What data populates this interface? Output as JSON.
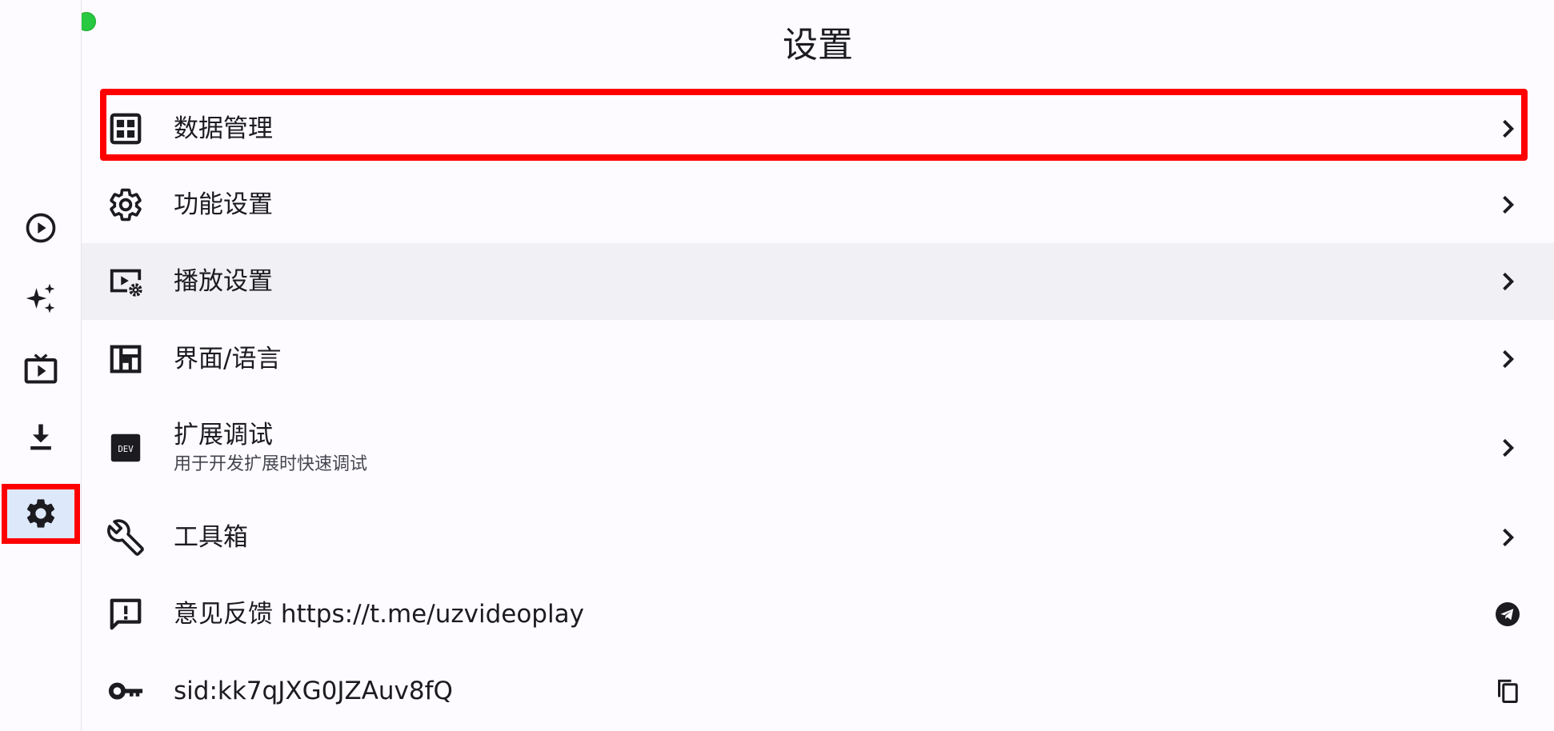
{
  "page": {
    "title": "设置"
  },
  "window_controls": {
    "close": "close",
    "minimize": "minimize",
    "maximize": "maximize"
  },
  "rail": {
    "items": [
      {
        "name": "play-circle-icon",
        "active": false
      },
      {
        "name": "sparkles-icon",
        "active": false
      },
      {
        "name": "tv-play-icon",
        "active": false
      },
      {
        "name": "download-icon",
        "active": false
      },
      {
        "name": "gear-icon",
        "active": true
      }
    ]
  },
  "settings": {
    "data_management": {
      "label": "数据管理",
      "icon": "grid-icon",
      "trailing_icon": "chevron-right-icon"
    },
    "feature_settings": {
      "label": "功能设置",
      "icon": "gear-icon",
      "trailing_icon": "chevron-right-icon"
    },
    "playback_settings": {
      "label": "播放设置",
      "icon": "video-settings-icon",
      "trailing_icon": "chevron-right-icon"
    },
    "ui_language": {
      "label": "界面/语言",
      "icon": "dashboard-icon",
      "trailing_icon": "chevron-right-icon"
    },
    "extension_debug": {
      "label": "扩展调试",
      "sublabel": "用于开发扩展时快速调试",
      "icon": "dev-icon",
      "icon_text": "DEV",
      "trailing_icon": "chevron-right-icon"
    },
    "toolbox": {
      "label": "工具箱",
      "icon": "wrench-icon",
      "trailing_icon": "chevron-right-icon"
    },
    "feedback": {
      "label": "意见反馈 https://t.me/uzvideoplay",
      "icon": "feedback-icon",
      "trailing_icon": "telegram-icon"
    },
    "sid": {
      "label": "sid:kk7qJXG0JZAuv8fQ",
      "icon": "key-icon",
      "trailing_icon": "copy-icon"
    }
  },
  "colors": {
    "background": "#fdfbff",
    "selected_rail": "#dde9fb",
    "hover_row": "#f1f0f4",
    "icon": "#1c1b1f",
    "highlight": "#ff0000",
    "traffic_close": "#fe5f57",
    "traffic_min": "#febc2e",
    "traffic_max": "#28c840"
  }
}
